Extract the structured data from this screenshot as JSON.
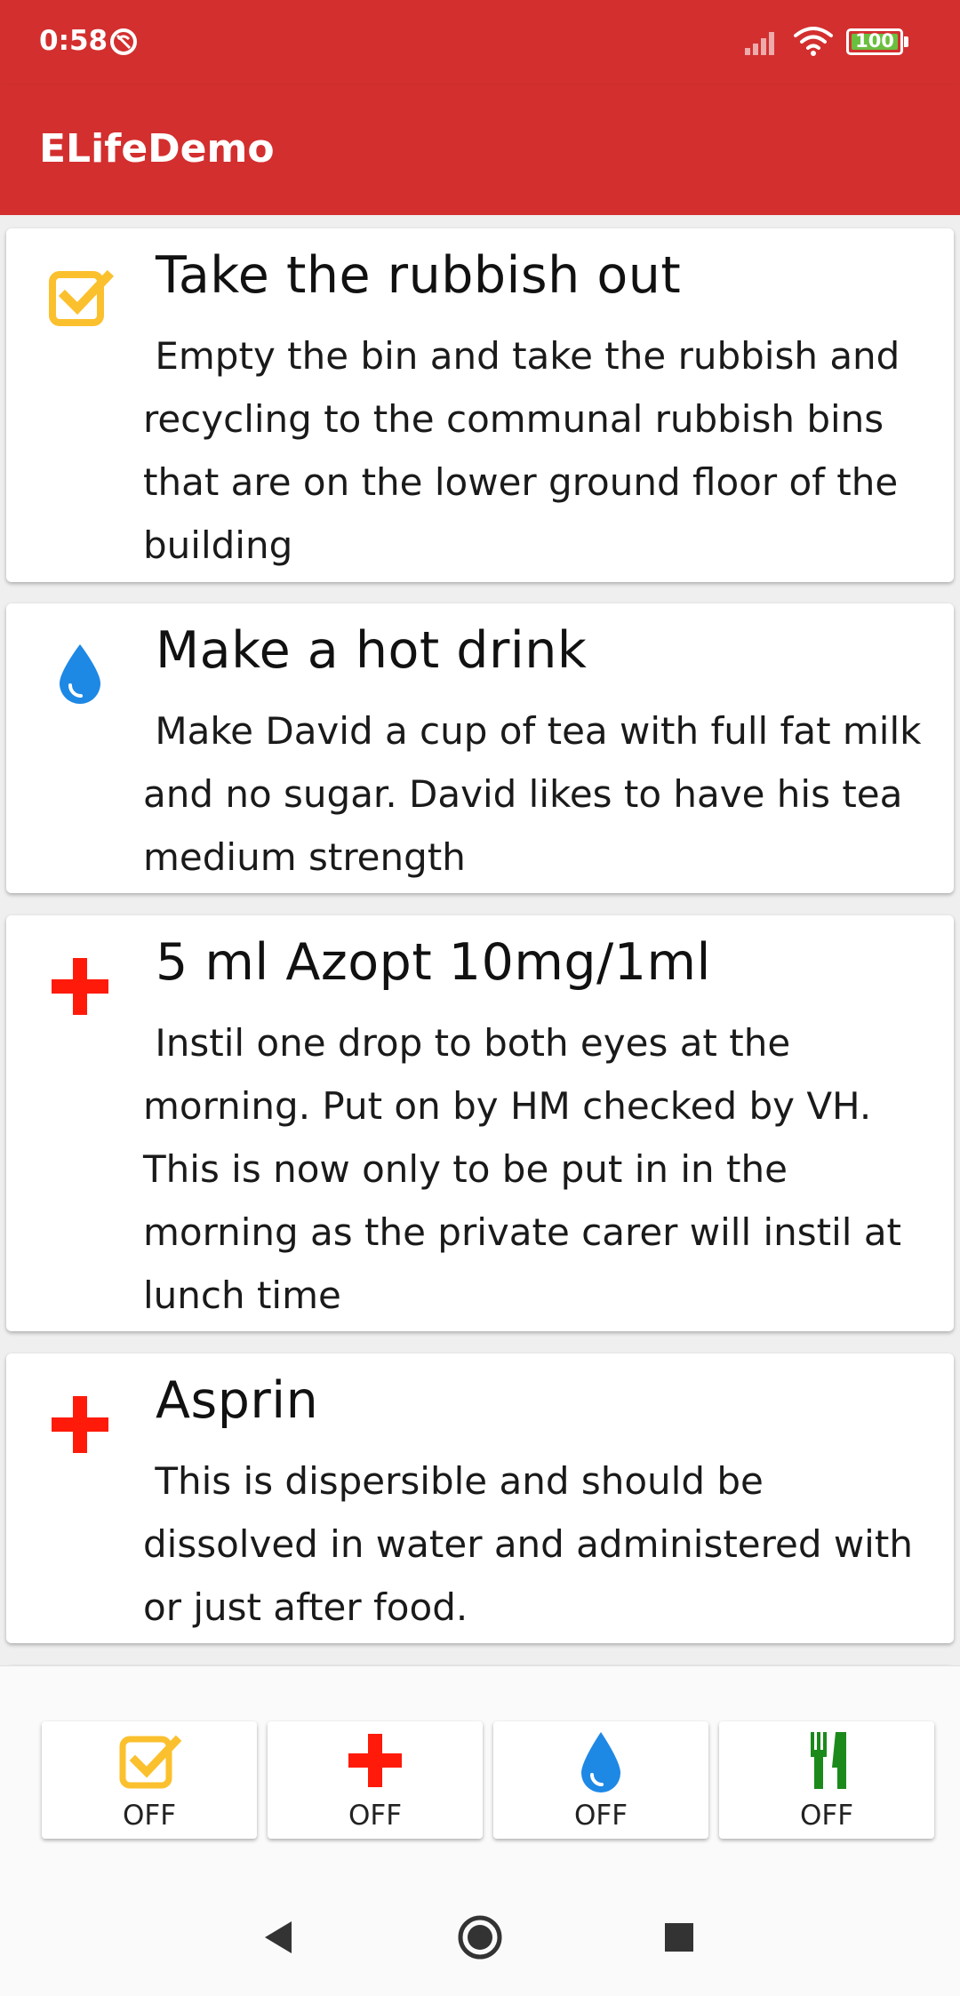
{
  "status_bar": {
    "time": "0:58",
    "battery": "100"
  },
  "app_bar": {
    "title": "ELifeDemo"
  },
  "tasks": [
    {
      "icon": "checkbox-icon",
      "icon_color": "#fbc02d",
      "title": "Take the rubbish out",
      "description": "Empty the bin and take the rubbish and recycling to the communal rubbish bins that are on the lower ground floor of the building"
    },
    {
      "icon": "water-drop-icon",
      "icon_color": "#1e88e5",
      "title": "Make a hot drink",
      "description": "Make David a cup of tea with full fat milk and no sugar.  David likes to have his tea medium strength"
    },
    {
      "icon": "medical-cross-icon",
      "icon_color": "#ff1a0a",
      "title": "5 ml Azopt 10mg/1ml",
      "description": "Instil one drop to both eyes at the morning. Put on by HM checked by VH. This is now only to be put in in the morning as the private carer will instil at lunch time"
    },
    {
      "icon": "medical-cross-icon",
      "icon_color": "#ff1a0a",
      "title": "Asprin",
      "description": "This is dispersible and should be dissolved in water and administered with or just after food."
    }
  ],
  "filters": [
    {
      "icon": "checkbox-icon",
      "icon_color": "#fbc02d",
      "label": "OFF"
    },
    {
      "icon": "medical-cross-icon",
      "icon_color": "#ff1a0a",
      "label": "OFF"
    },
    {
      "icon": "water-drop-icon",
      "icon_color": "#1e88e5",
      "label": "OFF"
    },
    {
      "icon": "fork-knife-icon",
      "icon_color": "#1b8a1b",
      "label": "OFF"
    }
  ],
  "colors": {
    "primary": "#d32f2f"
  }
}
